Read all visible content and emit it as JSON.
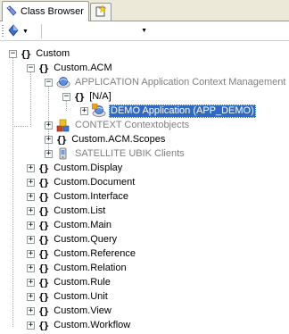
{
  "tabs": [
    {
      "label": "Class Browser",
      "icon": "class-browser-icon"
    },
    {
      "label": "",
      "icon": "new-document-icon"
    }
  ],
  "toolbar": {
    "filter_icon": "filter-diamond-icon",
    "select_value": ""
  },
  "tree": {
    "root": "Custom",
    "acm": "Custom.ACM",
    "application": "APPLICATION Application Context Management",
    "na": "[N/A]",
    "demo": "DEMO Application (APP_DEMO)",
    "context": "CONTEXT Contextobjects",
    "scopes": "Custom.ACM.Scopes",
    "satellite": "SATELLITE UBIK Clients",
    "items": [
      "Custom.Display",
      "Custom.Document",
      "Custom.Interface",
      "Custom.List",
      "Custom.Main",
      "Custom.Query",
      "Custom.Reference",
      "Custom.Relation",
      "Custom.Rule",
      "Custom.Unit",
      "Custom.View",
      "Custom.Workflow"
    ]
  },
  "colors": {
    "selection": "#316ac5",
    "disabled_text": "#808080"
  }
}
